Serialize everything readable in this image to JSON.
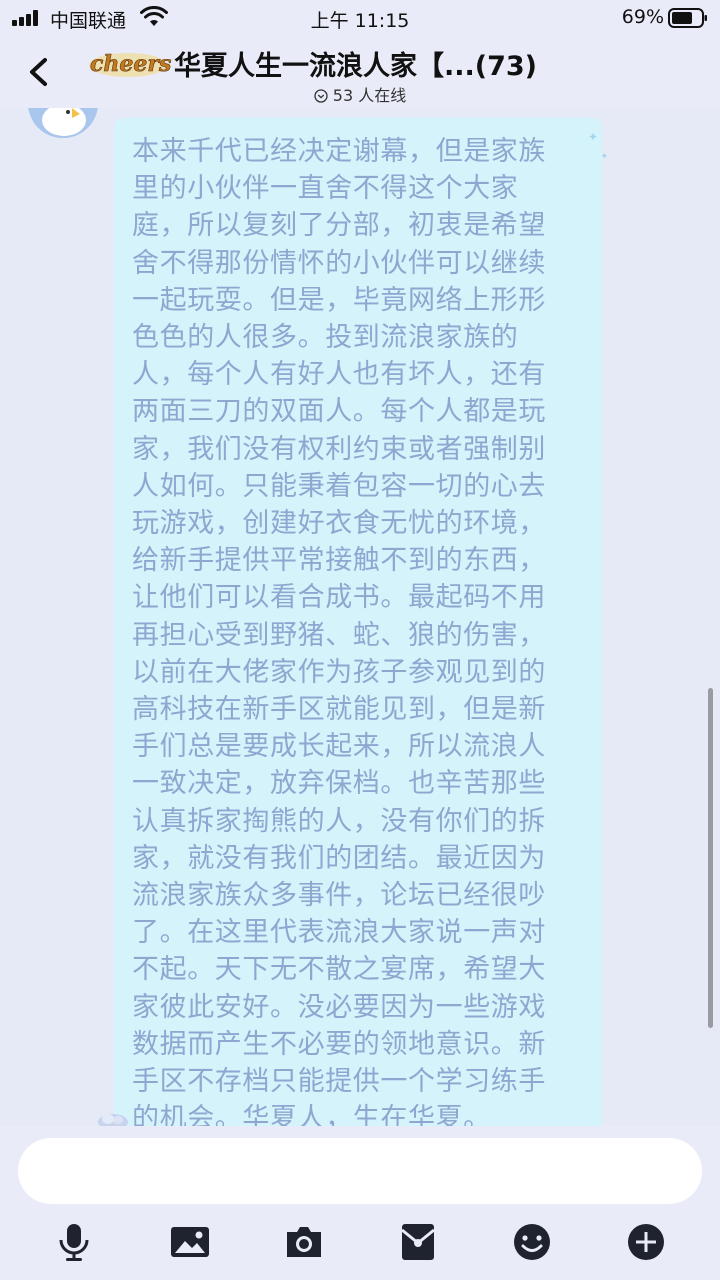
{
  "status_bar": {
    "carrier": "中国联通",
    "time": "上午 11:15",
    "battery": "69%",
    "icons": [
      "signal-icon",
      "wifi-icon",
      "battery-icon"
    ]
  },
  "header": {
    "back_icon": "chevron-left-icon",
    "logo_text": "cheers",
    "title": "华夏人生一流浪人家【...(73)",
    "online_icon": "chevron-down-circle-icon",
    "online": "53 人在线"
  },
  "message": {
    "lines": [
      "本来千代已经决定谢幕，但是家族",
      "里的小伙伴一直舍不得这个大家",
      "庭，所以复刻了分部，初衷是希望",
      "舍不得那份情怀的小伙伴可以继续",
      "一起玩耍。但是，毕竟网络上形形",
      "色色的人很多。投到流浪家族的",
      "人，每个人有好人也有坏人，还有",
      "两面三刀的双面人。每个人都是玩",
      "家，我们没有权利约束或者强制别",
      "人如何。只能秉着包容一切的心去",
      "玩游戏，创建好衣食无忧的环境，",
      "给新手提供平常接触不到的东西，",
      "让他们可以看合成书。最起码不用",
      "再担心受到野猪、蛇、狼的伤害，",
      "以前在大佬家作为孩子参观见到的",
      "高科技在新手区就能见到，但是新",
      "手们总是要成长起来，所以流浪人",
      "一致决定，放弃保档。也辛苦那些",
      "认真拆家掏熊的人，没有你们的拆",
      "家，就没有我们的团结。最近因为",
      "流浪家族众多事件，论坛已经很吵",
      "了。在这里代表流浪大家说一声对",
      "不起。天下无不散之宴席，希望大",
      "家彼此安好。没必要因为一些游戏",
      "数据而产生不必要的领地意识。新",
      "手区不存档只能提供一个学习练手",
      "的机会。华夏人，生在华夏。"
    ],
    "text_color": "#8fa6d0",
    "bubble_color": "#d5f3fb"
  },
  "input": {
    "placeholder": "",
    "toolbar": [
      "microphone-icon",
      "image-icon",
      "camera-icon",
      "red-packet-icon",
      "emoji-icon",
      "plus-icon"
    ]
  }
}
